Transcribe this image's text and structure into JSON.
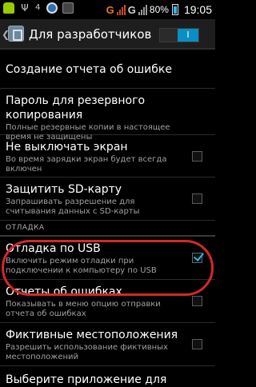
{
  "status_bar": {
    "left_icons": [
      "android-icon",
      "usb-icon",
      "notification-count",
      "globe-icon",
      "photo-icon"
    ],
    "usb_symbol": "Ψ",
    "notification_count": "4",
    "network1": "G",
    "network2": "G",
    "battery_percent": "80%",
    "time": "19:05"
  },
  "action_bar": {
    "title": "Для разработчиков",
    "toggle_label": "I"
  },
  "items": [
    {
      "title": "Создание отчета об ошибке",
      "summary": ""
    },
    {
      "title": "Пароль для резервного копирования",
      "summary": "Полные резервные копии в настоящее время не защищены"
    },
    {
      "title": "Не выключать экран",
      "summary": "Во время зарядки экран будет всегда включен",
      "checked": false
    },
    {
      "title": "Защитить SD-карту",
      "summary": "Запрашивать разрешение для считывания данных с SD-карты",
      "checked": false
    }
  ],
  "section_label": "ОТЛАДКА",
  "debug_items": [
    {
      "title": "Отладка по USB",
      "summary": "Включить режим отладки при подключении к компьютеру по USB",
      "checked": true
    },
    {
      "title": "Отчеты об ошибках",
      "summary": "Показывать в меню опцию отправки отчета об ошибках",
      "checked": false
    },
    {
      "title": "Фиктивные местоположения",
      "summary": "Разрешить использование фиктивных местоположений",
      "checked": false
    },
    {
      "title": "Выберите приложение для отладки",
      "summary": ""
    }
  ],
  "colors": {
    "accent": "#33b5e5",
    "toggle_on": "#0a8fc4",
    "highlight": "#d62828",
    "background": "#000000"
  }
}
